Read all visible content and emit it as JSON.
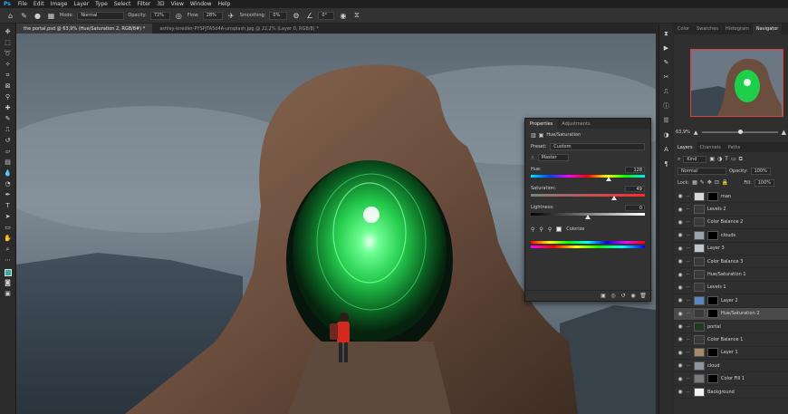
{
  "menubar": {
    "logo": "Ps",
    "items": [
      "File",
      "Edit",
      "Image",
      "Layer",
      "Type",
      "Select",
      "Filter",
      "3D",
      "View",
      "Window",
      "Help"
    ]
  },
  "options": {
    "mode_label": "Mode:",
    "mode_value": "Normal",
    "opacity_label": "Opacity:",
    "opacity_value": "72%",
    "flow_label": "Flow:",
    "flow_value": "28%",
    "smoothing_label": "Smoothing:",
    "smoothing_value": "0%",
    "angle_value": "0°"
  },
  "doc_tabs": [
    {
      "label": "the portal.psd @ 63,9% (Hue/Saturation 2, RGB/8#) *",
      "active": true
    },
    {
      "label": "ashley-knedler-PYSPJTA5d4A-unsplash.jpg @ 22,2% (Layer 0, RGB/8) *",
      "active": false
    }
  ],
  "properties": {
    "tab_properties": "Properties",
    "tab_adjustments": "Adjustments",
    "adjustment_name": "Hue/Saturation",
    "preset_label": "Preset:",
    "preset_value": "Custom",
    "channel_value": "Master",
    "hue_label": "Hue:",
    "hue_value": "128",
    "hue_fraction": 0.68,
    "saturation_label": "Saturation:",
    "saturation_value": "49",
    "saturation_fraction": 0.73,
    "lightness_label": "Lightness:",
    "lightness_value": "0",
    "lightness_fraction": 0.5,
    "colorize_label": "Colorize",
    "colorize_checked": true
  },
  "right_panel": {
    "tabs": [
      "Color",
      "Swatches",
      "Histogram",
      "Navigator"
    ],
    "active_tab": "Navigator",
    "zoom_value": "63,9%",
    "zoom_fraction": 0.5,
    "layers_tabs": [
      "Layers",
      "Channels",
      "Paths"
    ],
    "kind_label": "Kind",
    "blend_mode": "Normal",
    "opacity_label": "Opacity:",
    "opacity_value": "100%",
    "lock_label": "Lock:",
    "fill_label": "Fill:",
    "fill_value": "100%",
    "layers": [
      {
        "name": "man",
        "thumb": "#d9d9d9",
        "mask": true,
        "selected": false
      },
      {
        "name": "Levels 2",
        "thumb": "#3a3a3a",
        "mask": false,
        "selected": false
      },
      {
        "name": "Color Balance 2",
        "thumb": "#3a3a3a",
        "mask": false,
        "selected": false
      },
      {
        "name": "clouds",
        "thumb": "#9aa4ad",
        "mask": true,
        "selected": false
      },
      {
        "name": "Layer 3",
        "thumb": "#bfc8d0",
        "mask": false,
        "selected": false
      },
      {
        "name": "Color Balance 3",
        "thumb": "#3a3a3a",
        "mask": false,
        "selected": false
      },
      {
        "name": "Hue/Saturation 1",
        "thumb": "#3a3a3a",
        "mask": false,
        "selected": false
      },
      {
        "name": "Levels 1",
        "thumb": "#3a3a3a",
        "mask": false,
        "selected": false
      },
      {
        "name": "Layer 2",
        "thumb": "#5b86c2",
        "mask": true,
        "selected": false
      },
      {
        "name": "Hue/Saturation 2",
        "thumb": "#3a3a3a",
        "mask": true,
        "selected": true
      },
      {
        "name": "portal",
        "thumb": "#1e3a22",
        "mask": false,
        "selected": false
      },
      {
        "name": "Color Balance 1",
        "thumb": "#3a3a3a",
        "mask": false,
        "selected": false
      },
      {
        "name": "Layer 1",
        "thumb": "#a78a6a",
        "mask": true,
        "selected": false
      },
      {
        "name": "cloud",
        "thumb": "#8c959e",
        "mask": false,
        "selected": false
      },
      {
        "name": "Color Fill 1",
        "thumb": "#7a7a7a",
        "mask": true,
        "selected": false
      },
      {
        "name": "Background",
        "thumb": "#f2f2f2",
        "mask": false,
        "selected": false
      }
    ]
  },
  "colors": {
    "foreground": "#3aa8a0",
    "accent": "#31a8ff",
    "portal_green": "#39ff6a"
  }
}
